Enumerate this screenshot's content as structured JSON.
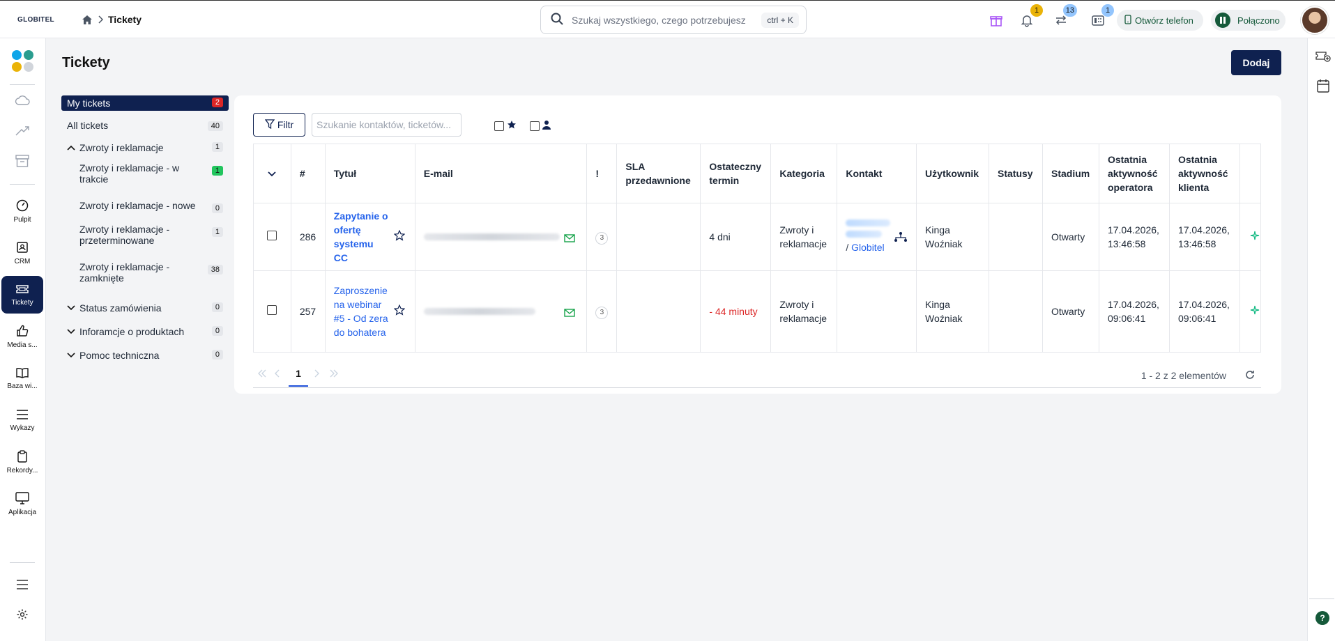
{
  "header": {
    "logo": "GLOBITEL",
    "breadcrumb_current": "Tickety",
    "search_placeholder": "Szukaj wszystkiego, czego potrzebujesz",
    "search_shortcut": "ctrl + K",
    "notifications_count": "1",
    "transfers_count": "13",
    "phone_count": "1",
    "open_phone_label": "Otwórz telefon",
    "status_label": "Połączono"
  },
  "nav": {
    "items": [
      {
        "label": "Pulpit",
        "icon": "gauge-icon"
      },
      {
        "label": "CRM",
        "icon": "contact-card-icon"
      },
      {
        "label": "Tickety",
        "icon": "ticket-icon"
      },
      {
        "label": "Media s...",
        "icon": "thumbs-up-icon"
      },
      {
        "label": "Baza wi...",
        "icon": "book-icon"
      },
      {
        "label": "Wykazy",
        "icon": "list-icon"
      },
      {
        "label": "Rekordy...",
        "icon": "clipboard-icon"
      },
      {
        "label": "Aplikacja",
        "icon": "monitor-icon"
      }
    ]
  },
  "page": {
    "title": "Tickety",
    "add_label": "Dodaj"
  },
  "categories": [
    {
      "label": "My tickets",
      "count": "2"
    },
    {
      "label": "All tickets",
      "count": "40"
    },
    {
      "label": "Zwroty i reklamacje",
      "count": "1"
    },
    {
      "label": "Zwroty i reklamacje - w trakcie",
      "count": "1"
    },
    {
      "label": "Zwroty i reklamacje - nowe",
      "count": "0"
    },
    {
      "label": "Zwroty i reklamacje - przeterminowane",
      "count": "1"
    },
    {
      "label": "Zwroty i reklamacje - zamknięte",
      "count": "38"
    },
    {
      "label": "Status zamówienia",
      "count": "0"
    },
    {
      "label": "Inforamcje o produktach",
      "count": "0"
    },
    {
      "label": "Pomoc techniczna",
      "count": "0"
    }
  ],
  "toolbar": {
    "filter_label": "Filtr",
    "search_placeholder": "Szukanie kontaktów, ticketów..."
  },
  "table": {
    "headers": [
      "#",
      "Tytuł",
      "E-mail",
      "!",
      "SLA przedawnione",
      "Ostateczny termin",
      "Kategoria",
      "Kontakt",
      "Użytkownik",
      "Statusy",
      "Stadium",
      "Ostatnia aktywność operatora",
      "Ostatnia aktywność klienta"
    ],
    "rows": [
      {
        "id": "286",
        "title": "Zapytanie o ofertę systemu CC",
        "priority": "3",
        "sla": "",
        "deadline": "4 dni",
        "category": "Zwroty i reklamacje",
        "contact_company": "Globitel",
        "user": "Kinga Woźniak",
        "statuses": "",
        "stage": "Otwarty",
        "op_activity": "17.04.2026, 13:46:58",
        "client_activity": "17.04.2026, 13:46:58"
      },
      {
        "id": "257",
        "title": "Zaproszenie na webinar #5 - Od zera do bohatera",
        "priority": "3",
        "sla": "",
        "deadline": "- 44 minuty",
        "category": "Zwroty i reklamacje",
        "contact_company": "",
        "user": "Kinga Woźniak",
        "statuses": "",
        "stage": "Otwarty",
        "op_activity": "17.04.2026, 09:06:41",
        "client_activity": "17.04.2026, 09:06:41"
      }
    ]
  },
  "pagination": {
    "current_page": "1",
    "info": "1 - 2 z 2 elementów"
  },
  "colors": {
    "primary": "#0f2150",
    "link": "#2563eb",
    "danger": "#dc2626",
    "success": "#22c55e"
  }
}
